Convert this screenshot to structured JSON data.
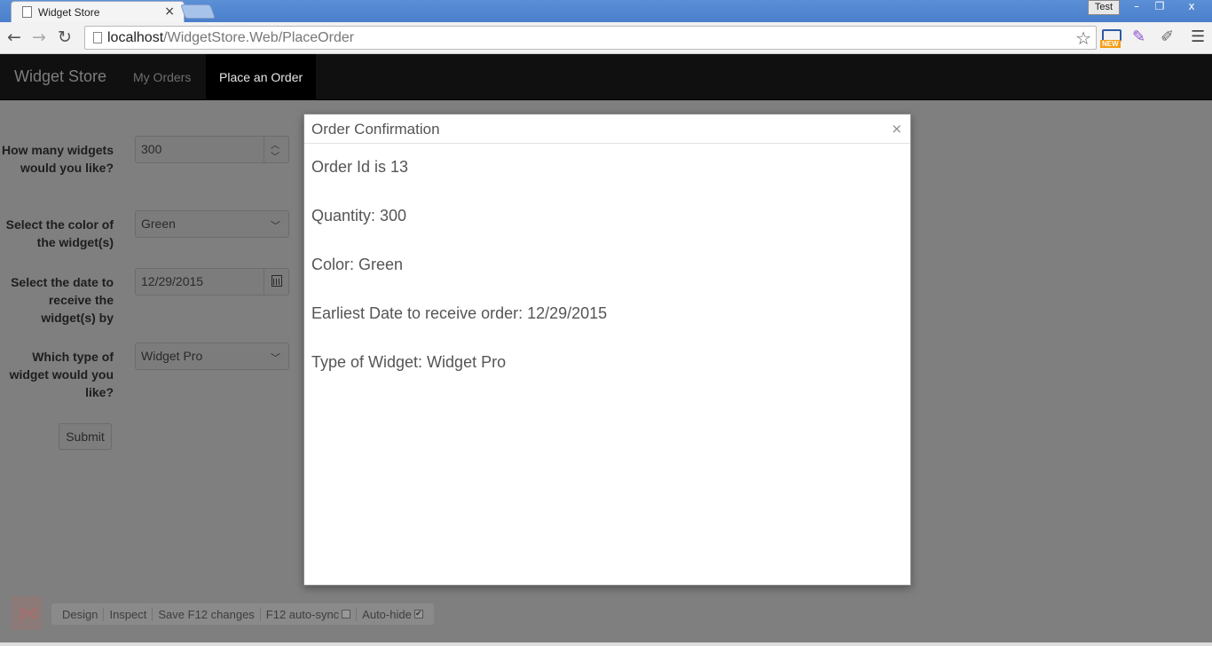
{
  "browser": {
    "tab_title": "Widget Store",
    "tab_close": "×",
    "user_label": "Test",
    "win_minimize": "–",
    "win_restore": "❐",
    "win_close": "x",
    "url_host": "localhost",
    "url_path": "/WidgetStore.Web/PlaceOrder",
    "ext_new_badge": "NEW"
  },
  "navbar": {
    "brand": "Widget Store",
    "links": [
      {
        "label": "My Orders"
      },
      {
        "label": "Place an Order"
      }
    ]
  },
  "form": {
    "quantity": {
      "label": "How many widgets would you like?",
      "value": "300"
    },
    "color": {
      "label": "Select the color of the widget(s)",
      "value": "Green"
    },
    "date": {
      "label": "Select the date to receive the widget(s) by",
      "value": "12/29/2015"
    },
    "type": {
      "label": "Which type of widget would you like?",
      "value": "Widget Pro"
    },
    "submit_label": "Submit"
  },
  "modal": {
    "title": "Order Confirmation",
    "close": "×",
    "lines": [
      "Order Id is 13",
      "Quantity: 300",
      "Color: Green",
      "Earliest Date to receive order: 12/29/2015",
      "Type of Widget: Widget Pro"
    ]
  },
  "browser_link": {
    "items": [
      "Design",
      "Inspect",
      "Save F12 changes",
      "F12 auto-sync",
      "Auto-hide"
    ],
    "auto_sync_checked": false,
    "auto_hide_checked": true
  }
}
